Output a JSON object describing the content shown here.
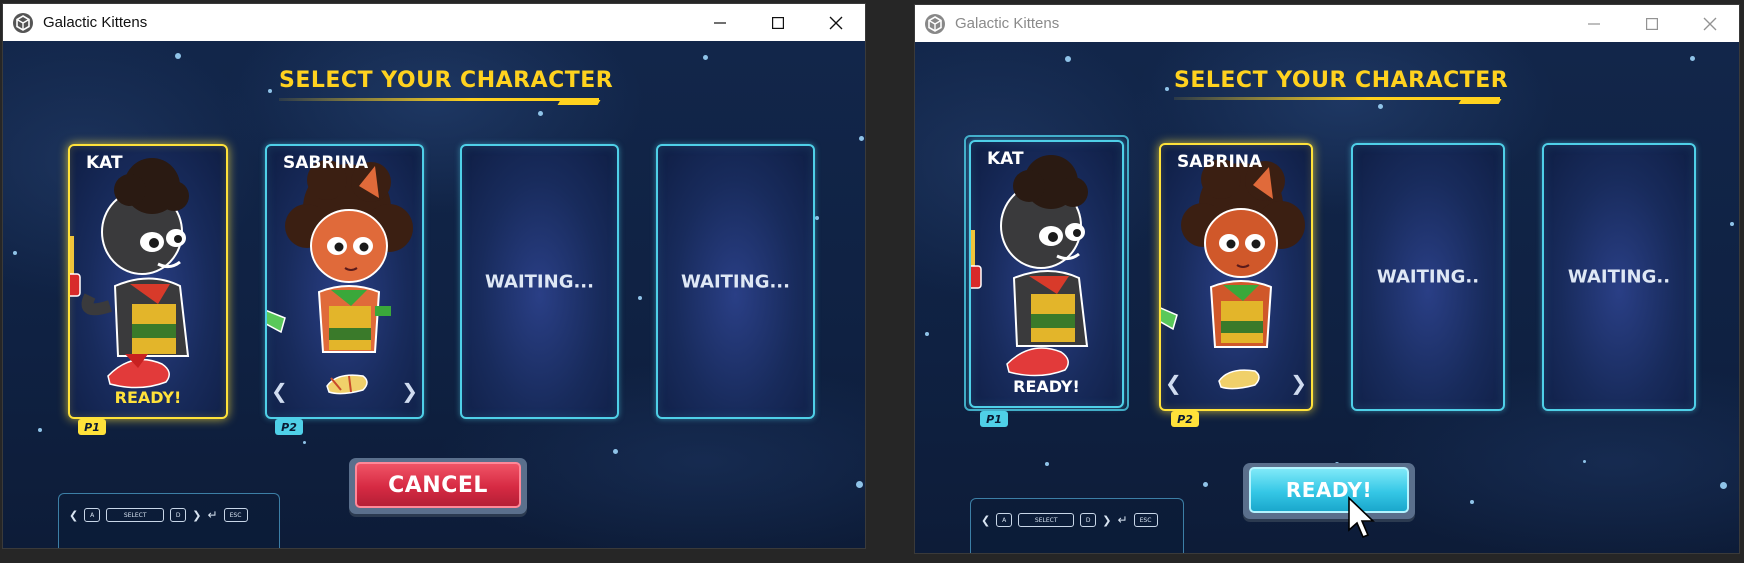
{
  "windows": [
    {
      "title": "Galactic Kittens",
      "heading": "SELECT YOUR CHARACTER",
      "cards": [
        {
          "name": "KAT",
          "status": "READY!",
          "player": "P1",
          "selected": true
        },
        {
          "name": "SABRINA",
          "status": "",
          "player": "P2",
          "selected": false,
          "nav_prev": "❮",
          "nav_next": "❯"
        },
        {
          "waiting": "WAITING..."
        },
        {
          "waiting": "WAITING..."
        }
      ],
      "button": "CANCEL",
      "controls": {
        "select_key": "SELECT",
        "esc_key": "ESC",
        "a_key": "A",
        "d_key": "D"
      }
    },
    {
      "title": "Galactic Kittens",
      "heading": "SELECT YOUR CHARACTER",
      "cards": [
        {
          "name": "KAT",
          "status": "READY!",
          "player": "P1",
          "selected": false
        },
        {
          "name": "SABRINA",
          "status": "",
          "player": "P2",
          "selected": true,
          "nav_prev": "❮",
          "nav_next": "❯"
        },
        {
          "waiting": "WAITING.."
        },
        {
          "waiting": "WAITING.."
        }
      ],
      "button": "READY!",
      "controls": {
        "select_key": "SELECT",
        "esc_key": "ESC",
        "a_key": "A",
        "d_key": "D"
      }
    }
  ],
  "colors": {
    "heading": "#ffd21f",
    "selected_border": "#ffe23a",
    "card_border": "#4fd0e8",
    "p1_tag": "#4fd0e8",
    "p2_tag_w1": "#4fd0e8",
    "p2_tag_w2": "#ffe23a",
    "cancel": "#d62a43",
    "ready": "#35c7e6"
  }
}
